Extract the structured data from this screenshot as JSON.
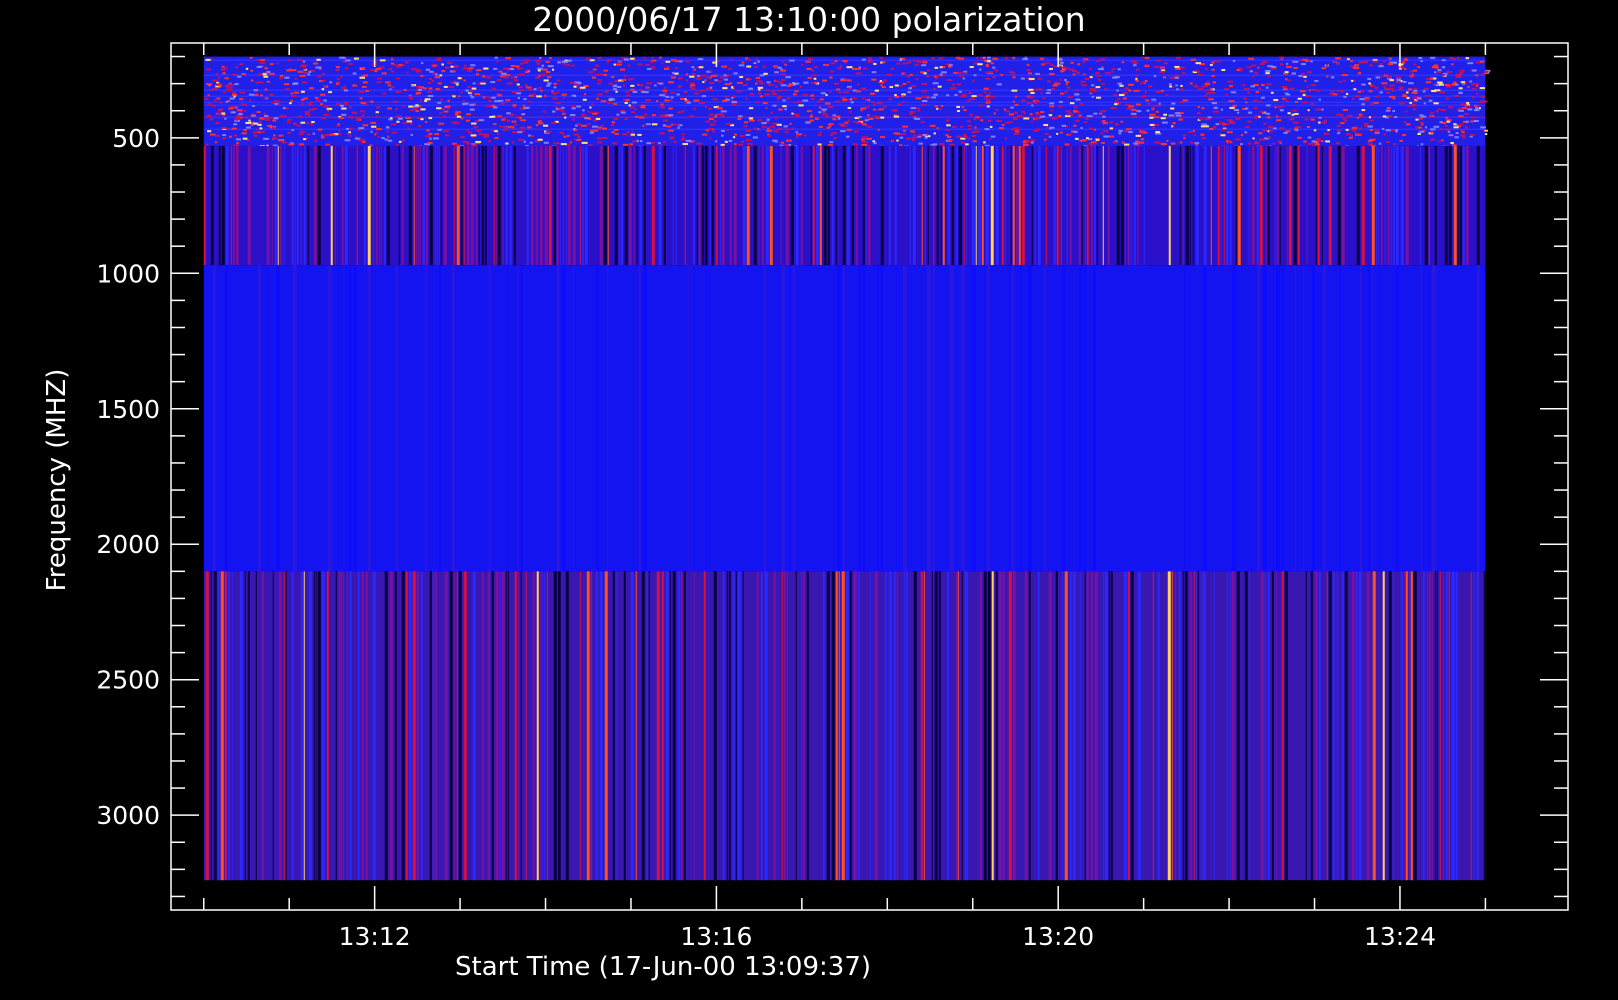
{
  "chart_data": {
    "type": "heatmap",
    "title": "2000/06/17 13:10:00 polarization",
    "xlabel": "Start Time (17-Jun-00 13:09:37)",
    "ylabel": "Frequency (MHZ)",
    "x_tick_labels": [
      "13:12",
      "13:16",
      "13:20",
      "13:24"
    ],
    "y_tick_labels": [
      "500",
      "1000",
      "1500",
      "2000",
      "2500",
      "3000"
    ],
    "y_tick_values": [
      500,
      1000,
      1500,
      2000,
      2500,
      3000
    ],
    "x_range": [
      "13:09:37",
      "13:25:58"
    ],
    "y_range_mhz": [
      150,
      3350
    ],
    "y_inverted": true,
    "data_extent": {
      "start": "13:10:00",
      "end": "13:25:00",
      "freq_min_mhz": 200,
      "freq_max_mhz": 3240
    },
    "bands": [
      {
        "freq_range_mhz": [
          200,
          530
        ],
        "pattern": "speckled noise",
        "dominant_color": "#2020e8"
      },
      {
        "freq_range_mhz": [
          530,
          970
        ],
        "pattern": "vertical striations",
        "dominant_color": "#2a10c8"
      },
      {
        "freq_range_mhz": [
          970,
          2100
        ],
        "pattern": "uniform",
        "dominant_color": "#1414f0"
      },
      {
        "freq_range_mhz": [
          2100,
          3240
        ],
        "pattern": "vertical striations",
        "dominant_color": "#3818b0"
      }
    ],
    "colormap": [
      "#000000",
      "#1010ff",
      "#ff0000",
      "#ffff80"
    ],
    "grid": false,
    "legend": "none"
  }
}
